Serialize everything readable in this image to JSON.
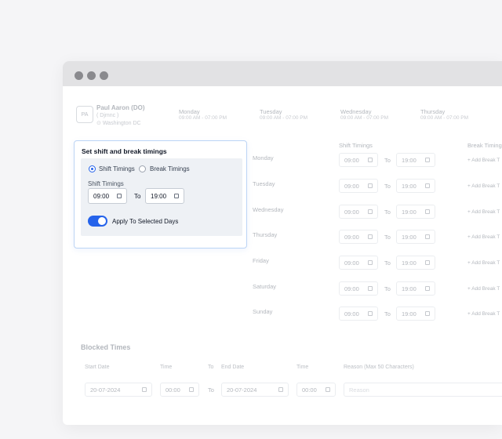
{
  "employee": {
    "initials": "PA",
    "name": "Paul Aaron (DO)",
    "role": "( Djmnc )",
    "location": "Washington DC"
  },
  "week_header": [
    {
      "day": "Monday",
      "time": "09:00 AM - 07:00 PM"
    },
    {
      "day": "Tuesday",
      "time": "09:00 AM - 07:00 PM"
    },
    {
      "day": "Wednesday",
      "time": "09:00 AM - 07:00 PM"
    },
    {
      "day": "Thursday",
      "time": "09:00 AM - 07:00 PM"
    }
  ],
  "schedule": {
    "shift_timings_header": "Shift Timings",
    "break_timings_header": "Break Timing",
    "to_label": "To",
    "add_break_label": "+ Add Break T",
    "rows": [
      {
        "day": "Monday",
        "start": "09:00",
        "end": "19:00"
      },
      {
        "day": "Tuesday",
        "start": "09:00",
        "end": "19:00"
      },
      {
        "day": "Wednesday",
        "start": "09:00",
        "end": "19:00"
      },
      {
        "day": "Thursday",
        "start": "09:00",
        "end": "19:00"
      },
      {
        "day": "Friday",
        "start": "09:00",
        "end": "19:00"
      },
      {
        "day": "Saturday",
        "start": "09:00",
        "end": "19:00"
      },
      {
        "day": "Sunday",
        "start": "09:00",
        "end": "19:00"
      }
    ]
  },
  "blocked_times": {
    "title": "Blocked Times",
    "start_date_label": "Start Date",
    "time_label": "Time",
    "to_label": "To",
    "end_date_label": "End Date",
    "time2_label": "Time",
    "reason_label": "Reason (Max 50 Characters)",
    "start_date": "20-07-2024",
    "start_time": "00:00",
    "end_date": "20-07-2024",
    "end_time": "00:00",
    "reason_placeholder": "Reason"
  },
  "popup": {
    "title": "Set shift and break timings",
    "option_shift": "Shift Timings",
    "option_break": "Break Timings",
    "selected": "shift",
    "sub_label": "Shift Timings",
    "start": "09:00",
    "to_label": "To",
    "end": "19:00",
    "apply_label": "Apply To Selected Days",
    "apply_on": true
  },
  "colors": {
    "accent": "#2563eb",
    "popup_bg": "#eef1f5"
  }
}
